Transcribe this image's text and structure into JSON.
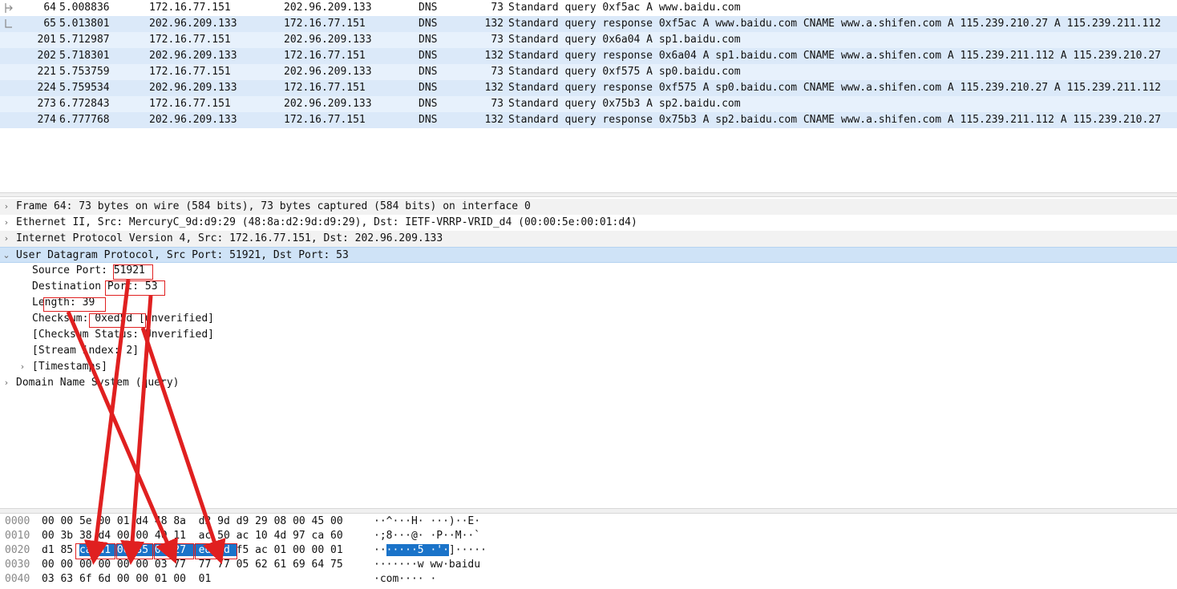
{
  "packets": [
    {
      "no": "64",
      "time": "5.008836",
      "src": "172.16.77.151",
      "dst": "202.96.209.133",
      "proto": "DNS",
      "len": "73",
      "info": "Standard query 0xf5ac A www.baidu.com"
    },
    {
      "no": "65",
      "time": "5.013801",
      "src": "202.96.209.133",
      "dst": "172.16.77.151",
      "proto": "DNS",
      "len": "132",
      "info": "Standard query response 0xf5ac A www.baidu.com CNAME www.a.shifen.com A 115.239.210.27 A 115.239.211.112"
    },
    {
      "no": "201",
      "time": "5.712987",
      "src": "172.16.77.151",
      "dst": "202.96.209.133",
      "proto": "DNS",
      "len": "73",
      "info": "Standard query 0x6a04 A sp1.baidu.com"
    },
    {
      "no": "202",
      "time": "5.718301",
      "src": "202.96.209.133",
      "dst": "172.16.77.151",
      "proto": "DNS",
      "len": "132",
      "info": "Standard query response 0x6a04 A sp1.baidu.com CNAME www.a.shifen.com A 115.239.211.112 A 115.239.210.27"
    },
    {
      "no": "221",
      "time": "5.753759",
      "src": "172.16.77.151",
      "dst": "202.96.209.133",
      "proto": "DNS",
      "len": "73",
      "info": "Standard query 0xf575 A sp0.baidu.com"
    },
    {
      "no": "224",
      "time": "5.759534",
      "src": "202.96.209.133",
      "dst": "172.16.77.151",
      "proto": "DNS",
      "len": "132",
      "info": "Standard query response 0xf575 A sp0.baidu.com CNAME www.a.shifen.com A 115.239.210.27 A 115.239.211.112"
    },
    {
      "no": "273",
      "time": "6.772843",
      "src": "172.16.77.151",
      "dst": "202.96.209.133",
      "proto": "DNS",
      "len": "73",
      "info": "Standard query 0x75b3 A sp2.baidu.com"
    },
    {
      "no": "274",
      "time": "6.777768",
      "src": "202.96.209.133",
      "dst": "172.16.77.151",
      "proto": "DNS",
      "len": "132",
      "info": "Standard query response 0x75b3 A sp2.baidu.com CNAME www.a.shifen.com A 115.239.211.112 A 115.239.210.27"
    }
  ],
  "details": [
    {
      "text": "Frame 64: 73 bytes on wire (584 bits), 73 bytes captured (584 bits) on interface 0",
      "arrow": "›"
    },
    {
      "text": "Ethernet II, Src: MercuryC_9d:d9:29 (48:8a:d2:9d:d9:29), Dst: IETF-VRRP-VRID_d4 (00:00:5e:00:01:d4)",
      "arrow": "›"
    },
    {
      "text": "Internet Protocol Version 4, Src: 172.16.77.151, Dst: 202.96.209.133",
      "arrow": "›"
    },
    {
      "text": "User Datagram Protocol, Src Port: 51921, Dst Port: 53",
      "arrow": "⌄"
    },
    {
      "text": "Source Port: 51921",
      "arrow": ""
    },
    {
      "text": "Destination Port: 53",
      "arrow": ""
    },
    {
      "text": "Length: 39",
      "arrow": ""
    },
    {
      "text": "Checksum: 0xed5d [unverified]",
      "arrow": ""
    },
    {
      "text": "[Checksum Status: Unverified]",
      "arrow": ""
    },
    {
      "text": "[Stream index: 2]",
      "arrow": ""
    },
    {
      "text": "[Timestamps]",
      "arrow": "›"
    },
    {
      "text": "Domain Name System (query)",
      "arrow": "›"
    }
  ],
  "hex": [
    {
      "offset": "0000",
      "bytes": "00 00 5e 00 01 d4 48 8a  d2 9d d9 29 08 00 45 00",
      "ascii": "··^···H· ···)··E·"
    },
    {
      "offset": "0010",
      "bytes": "00 3b 38 d4 00 00 40 11  ac 50 ac 10 4d 97 ca 60",
      "ascii": "·;8···@· ·P··M··`"
    },
    {
      "offset": "0020",
      "bytes": "d1 85 ca d1 00 35 00 27  ed 5d f5 ac 01 00 00 01",
      "ascii": "·······5 ·'·]·····"
    },
    {
      "offset": "0030",
      "bytes": "00 00 00 00 00 00 03 77  77 77 05 62 61 69 64 75",
      "ascii": "·······w ww·baidu"
    },
    {
      "offset": "0040",
      "bytes": "03 63 6f 6d 00 00 01 00  01",
      "ascii": "·com···· ·"
    }
  ],
  "colors": {
    "accent": "#1a73c9",
    "annotation": "#e02020",
    "selected_row": "#cfe3f7",
    "list_row_a": "#e7f1fc",
    "list_row_b": "#dbe9f9"
  }
}
